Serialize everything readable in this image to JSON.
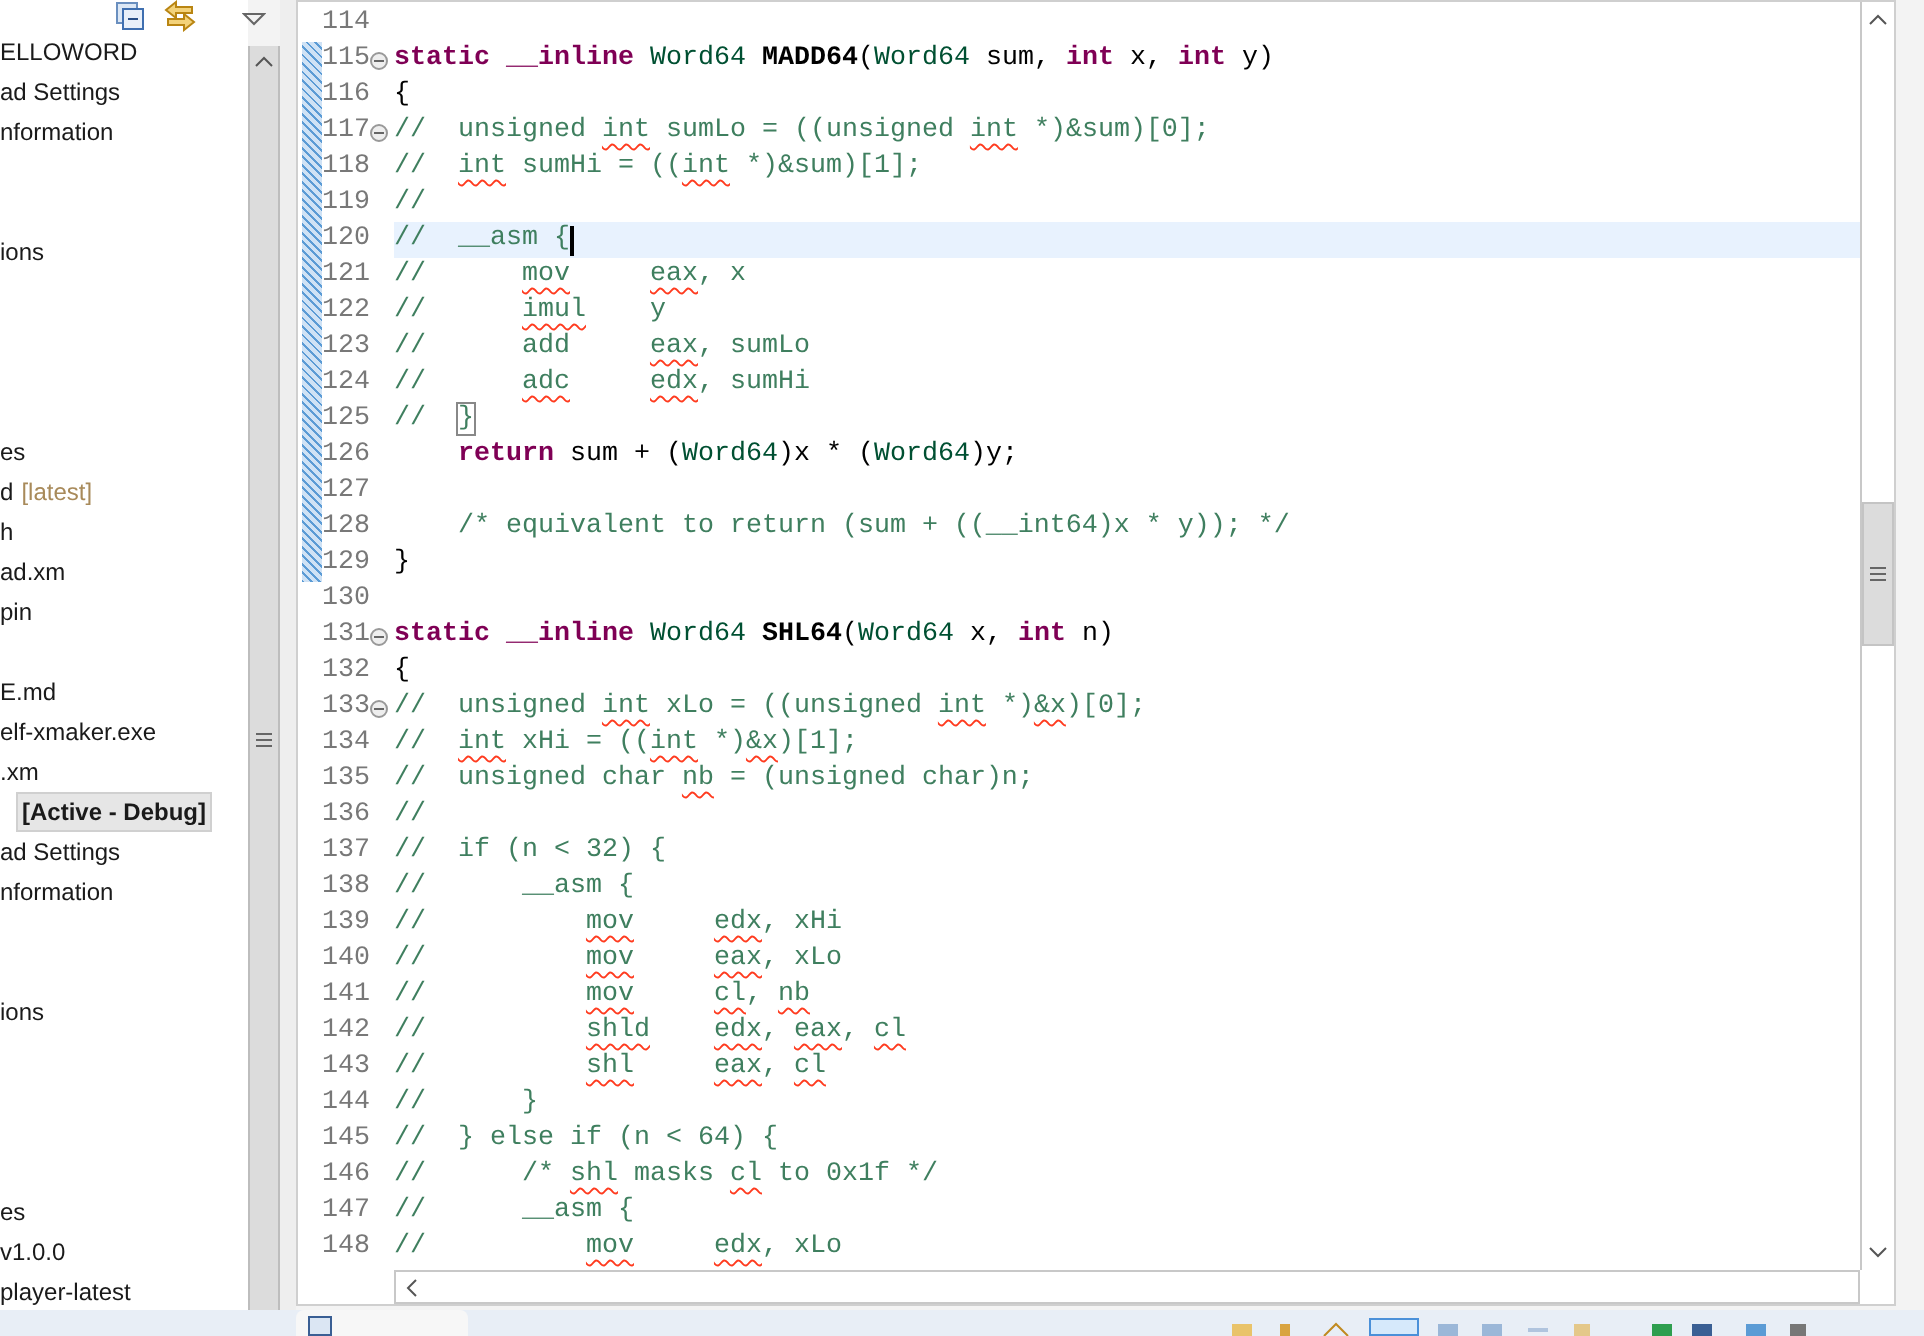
{
  "sidebar": {
    "items": [
      {
        "kind": "item",
        "text": "ELLOWORD",
        "selected": false
      },
      {
        "kind": "item",
        "text": "ad Settings",
        "selected": false
      },
      {
        "kind": "item",
        "text": "nformation",
        "selected": false
      },
      {
        "kind": "hidden"
      },
      {
        "kind": "hidden"
      },
      {
        "kind": "item",
        "text": "ions",
        "selected": false
      },
      {
        "kind": "hidden"
      },
      {
        "kind": "hidden"
      },
      {
        "kind": "hidden"
      },
      {
        "kind": "hidden"
      },
      {
        "kind": "item",
        "text": "es",
        "selected": false
      },
      {
        "kind": "item",
        "text": "d",
        "suffix": "[latest]",
        "selected": false
      },
      {
        "kind": "item",
        "text": "h",
        "selected": false
      },
      {
        "kind": "item",
        "text": "ad.xm",
        "selected": false
      },
      {
        "kind": "item",
        "text": "pin",
        "selected": false
      },
      {
        "kind": "hidden"
      },
      {
        "kind": "item",
        "text": "E.md",
        "selected": false
      },
      {
        "kind": "item",
        "text": "elf-xmaker.exe",
        "selected": false
      },
      {
        "kind": "item",
        "text": ".xm",
        "selected": false
      },
      {
        "kind": "item",
        "text": "[Active - Debug]",
        "selected": true
      },
      {
        "kind": "item",
        "text": "ad Settings",
        "selected": false
      },
      {
        "kind": "item",
        "text": "nformation",
        "selected": false
      },
      {
        "kind": "hidden"
      },
      {
        "kind": "hidden"
      },
      {
        "kind": "item",
        "text": "ions",
        "selected": false
      },
      {
        "kind": "hidden"
      },
      {
        "kind": "hidden"
      },
      {
        "kind": "hidden"
      },
      {
        "kind": "hidden"
      },
      {
        "kind": "item",
        "text": "es",
        "selected": false
      },
      {
        "kind": "item",
        "text": "v1.0.0",
        "selected": false
      },
      {
        "kind": "item",
        "text": "player-latest",
        "selected": false
      }
    ]
  },
  "editor": {
    "lines": [
      {
        "number": "114",
        "current": false,
        "fold": false
      },
      {
        "number": "115",
        "current": false,
        "fold": true,
        "tokens": [
          {
            "text": "static __inline",
            "kind": "keyword"
          },
          {
            "text": " Word64 ",
            "kind": "type"
          },
          {
            "text": "MADD64",
            "kind": "function"
          },
          {
            "text": "(",
            "kind": "plain"
          },
          {
            "text": "Word64",
            "kind": "type"
          },
          {
            "text": " sum, ",
            "kind": "plain"
          },
          {
            "text": "int",
            "kind": "keyword"
          },
          {
            "text": " x, ",
            "kind": "plain"
          },
          {
            "text": "int",
            "kind": "keyword"
          },
          {
            "text": " y)",
            "kind": "plain"
          }
        ]
      },
      {
        "number": "116",
        "current": false,
        "fold": false,
        "tokens": [
          {
            "text": "{",
            "kind": "plain"
          }
        ]
      },
      {
        "number": "117",
        "current": false,
        "fold": true,
        "tokens": [
          {
            "text": "//  unsigned ",
            "kind": "comment"
          },
          {
            "text": "int",
            "kind": "comment",
            "misspelled": true
          },
          {
            "text": " sumLo = ((unsigned ",
            "kind": "comment"
          },
          {
            "text": "int",
            "kind": "comment",
            "misspelled": true
          },
          {
            "text": " *)&sum)[0];",
            "kind": "comment"
          }
        ]
      },
      {
        "number": "118",
        "current": false,
        "fold": false,
        "tokens": [
          {
            "text": "//  ",
            "kind": "comment"
          },
          {
            "text": "int",
            "kind": "comment",
            "misspelled": true
          },
          {
            "text": " sumHi = ((",
            "kind": "comment"
          },
          {
            "text": "int",
            "kind": "comment",
            "misspelled": true
          },
          {
            "text": " *)&sum)[1];",
            "kind": "comment"
          }
        ]
      },
      {
        "number": "119",
        "current": false,
        "fold": false,
        "tokens": [
          {
            "text": "//",
            "kind": "comment"
          }
        ]
      },
      {
        "number": "120",
        "current": true,
        "fold": false,
        "tokens": [
          {
            "text": "//  __asm {",
            "kind": "comment"
          }
        ]
      },
      {
        "number": "121",
        "current": false,
        "fold": false,
        "tokens": [
          {
            "text": "//      ",
            "kind": "comment"
          },
          {
            "text": "mov     ",
            "kind": "comment",
            "misspelled": true
          },
          {
            "text": "eax",
            "kind": "comment",
            "misspelled": true
          },
          {
            "text": ", x",
            "kind": "comment"
          }
        ]
      },
      {
        "number": "122",
        "current": false,
        "fold": false,
        "tokens": [
          {
            "text": "//      ",
            "kind": "comment"
          },
          {
            "text": "imul",
            "kind": "comment",
            "misspelled": true
          },
          {
            "text": "    y",
            "kind": "comment"
          }
        ]
      },
      {
        "number": "123",
        "current": false,
        "fold": false,
        "tokens": [
          {
            "text": "//      add     ",
            "kind": "comment"
          },
          {
            "text": "eax",
            "kind": "comment",
            "misspelled": true
          },
          {
            "text": ", sumLo",
            "kind": "comment"
          }
        ]
      },
      {
        "number": "124",
        "current": false,
        "fold": false,
        "tokens": [
          {
            "text": "//      ",
            "kind": "comment"
          },
          {
            "text": "adc     ",
            "kind": "comment",
            "misspelled": true
          },
          {
            "text": "edx",
            "kind": "comment",
            "misspelled": true
          },
          {
            "text": ", sumHi",
            "kind": "comment"
          }
        ]
      },
      {
        "number": "125",
        "current": false,
        "fold": false,
        "tokens": [
          {
            "text": "//  ",
            "kind": "comment"
          },
          {
            "text": "}",
            "kind": "comment",
            "matched": true
          }
        ]
      },
      {
        "number": "126",
        "current": false,
        "fold": false,
        "tokens": [
          {
            "text": "    return",
            "kind": "keyword"
          },
          {
            "text": " sum + (",
            "kind": "plain"
          },
          {
            "text": "Word64",
            "kind": "type"
          },
          {
            "text": ")x * (",
            "kind": "plain"
          },
          {
            "text": "Word64",
            "kind": "type"
          },
          {
            "text": ")y;",
            "kind": "plain"
          }
        ]
      },
      {
        "number": "127",
        "current": false,
        "fold": false
      },
      {
        "number": "128",
        "current": false,
        "fold": false,
        "tokens": [
          {
            "text": "    /* equivalent to return (sum + ((__int64)x * y)); */",
            "kind": "comment"
          }
        ]
      },
      {
        "number": "129",
        "current": false,
        "fold": false,
        "tokens": [
          {
            "text": "}",
            "kind": "plain"
          }
        ]
      },
      {
        "number": "130",
        "current": false,
        "fold": false
      },
      {
        "number": "131",
        "current": false,
        "fold": true,
        "tokens": [
          {
            "text": "static __inline",
            "kind": "keyword"
          },
          {
            "text": " Word64 ",
            "kind": "type"
          },
          {
            "text": "SHL64",
            "kind": "function"
          },
          {
            "text": "(",
            "kind": "plain"
          },
          {
            "text": "Word64",
            "kind": "type"
          },
          {
            "text": " x, ",
            "kind": "plain"
          },
          {
            "text": "int",
            "kind": "keyword"
          },
          {
            "text": " n)",
            "kind": "plain"
          }
        ]
      },
      {
        "number": "132",
        "current": false,
        "fold": false,
        "tokens": [
          {
            "text": "{",
            "kind": "plain"
          }
        ]
      },
      {
        "number": "133",
        "current": false,
        "fold": true,
        "tokens": [
          {
            "text": "//  unsigned ",
            "kind": "comment"
          },
          {
            "text": "int",
            "kind": "comment",
            "misspelled": true
          },
          {
            "text": " xLo = ((unsigned ",
            "kind": "comment"
          },
          {
            "text": "int",
            "kind": "comment",
            "misspelled": true
          },
          {
            "text": " *)",
            "kind": "comment"
          },
          {
            "text": "&x",
            "kind": "comment",
            "misspelled": true
          },
          {
            "text": ")[0];",
            "kind": "comment"
          }
        ]
      },
      {
        "number": "134",
        "current": false,
        "fold": false,
        "tokens": [
          {
            "text": "//  ",
            "kind": "comment"
          },
          {
            "text": "int",
            "kind": "comment",
            "misspelled": true
          },
          {
            "text": " xHi = ((",
            "kind": "comment"
          },
          {
            "text": "int",
            "kind": "comment",
            "misspelled": true
          },
          {
            "text": " *)",
            "kind": "comment"
          },
          {
            "text": "&x",
            "kind": "comment",
            "misspelled": true
          },
          {
            "text": ")[1];",
            "kind": "comment"
          }
        ]
      },
      {
        "number": "135",
        "current": false,
        "fold": false,
        "tokens": [
          {
            "text": "//  unsigned char ",
            "kind": "comment"
          },
          {
            "text": "nb",
            "kind": "comment",
            "misspelled": true
          },
          {
            "text": " = (unsigned char)n;",
            "kind": "comment"
          }
        ]
      },
      {
        "number": "136",
        "current": false,
        "fold": false,
        "tokens": [
          {
            "text": "//",
            "kind": "comment"
          }
        ]
      },
      {
        "number": "137",
        "current": false,
        "fold": false,
        "tokens": [
          {
            "text": "//  if (n < 32) {",
            "kind": "comment"
          }
        ]
      },
      {
        "number": "138",
        "current": false,
        "fold": false,
        "tokens": [
          {
            "text": "//      __asm {",
            "kind": "comment"
          }
        ]
      },
      {
        "number": "139",
        "current": false,
        "fold": false,
        "tokens": [
          {
            "text": "//          ",
            "kind": "comment"
          },
          {
            "text": "mov     ",
            "kind": "comment",
            "misspelled": true
          },
          {
            "text": "edx",
            "kind": "comment",
            "misspelled": true
          },
          {
            "text": ", xHi",
            "kind": "comment"
          }
        ]
      },
      {
        "number": "140",
        "current": false,
        "fold": false,
        "tokens": [
          {
            "text": "//          ",
            "kind": "comment"
          },
          {
            "text": "mov     ",
            "kind": "comment",
            "misspelled": true
          },
          {
            "text": "eax",
            "kind": "comment",
            "misspelled": true
          },
          {
            "text": ", xLo",
            "kind": "comment"
          }
        ]
      },
      {
        "number": "141",
        "current": false,
        "fold": false,
        "tokens": [
          {
            "text": "//          ",
            "kind": "comment"
          },
          {
            "text": "mov     ",
            "kind": "comment",
            "misspelled": true
          },
          {
            "text": "cl",
            "kind": "comment",
            "misspelled": true
          },
          {
            "text": ", ",
            "kind": "comment"
          },
          {
            "text": "nb",
            "kind": "comment",
            "misspelled": true
          }
        ]
      },
      {
        "number": "142",
        "current": false,
        "fold": false,
        "tokens": [
          {
            "text": "//          ",
            "kind": "comment"
          },
          {
            "text": "shld    ",
            "kind": "comment",
            "misspelled": true
          },
          {
            "text": "edx",
            "kind": "comment",
            "misspelled": true
          },
          {
            "text": ", ",
            "kind": "comment"
          },
          {
            "text": "eax",
            "kind": "comment",
            "misspelled": true
          },
          {
            "text": ", ",
            "kind": "comment"
          },
          {
            "text": "cl",
            "kind": "comment",
            "misspelled": true
          }
        ]
      },
      {
        "number": "143",
        "current": false,
        "fold": false,
        "tokens": [
          {
            "text": "//          ",
            "kind": "comment"
          },
          {
            "text": "shl     ",
            "kind": "comment",
            "misspelled": true
          },
          {
            "text": "eax",
            "kind": "comment",
            "misspelled": true
          },
          {
            "text": ", ",
            "kind": "comment"
          },
          {
            "text": "cl",
            "kind": "comment",
            "misspelled": true
          }
        ]
      },
      {
        "number": "144",
        "current": false,
        "fold": false,
        "tokens": [
          {
            "text": "//      }",
            "kind": "comment"
          }
        ]
      },
      {
        "number": "145",
        "current": false,
        "fold": false,
        "tokens": [
          {
            "text": "//  } else if (n < 64) {",
            "kind": "comment"
          }
        ]
      },
      {
        "number": "146",
        "current": false,
        "fold": false,
        "tokens": [
          {
            "text": "//      /* ",
            "kind": "comment"
          },
          {
            "text": "shl",
            "kind": "comment",
            "misspelled": true
          },
          {
            "text": " masks ",
            "kind": "comment"
          },
          {
            "text": "cl",
            "kind": "comment",
            "misspelled": true
          },
          {
            "text": " to 0x1f */",
            "kind": "comment"
          }
        ]
      },
      {
        "number": "147",
        "current": false,
        "fold": false,
        "tokens": [
          {
            "text": "//      __asm {",
            "kind": "comment"
          }
        ]
      },
      {
        "number": "148",
        "current": false,
        "fold": false,
        "tokens": [
          {
            "text": "//          ",
            "kind": "comment"
          },
          {
            "text": "mov     ",
            "kind": "comment",
            "misspelled": true
          },
          {
            "text": "edx",
            "kind": "comment",
            "misspelled": true
          },
          {
            "text": ", xLo",
            "kind": "comment"
          }
        ]
      }
    ]
  }
}
